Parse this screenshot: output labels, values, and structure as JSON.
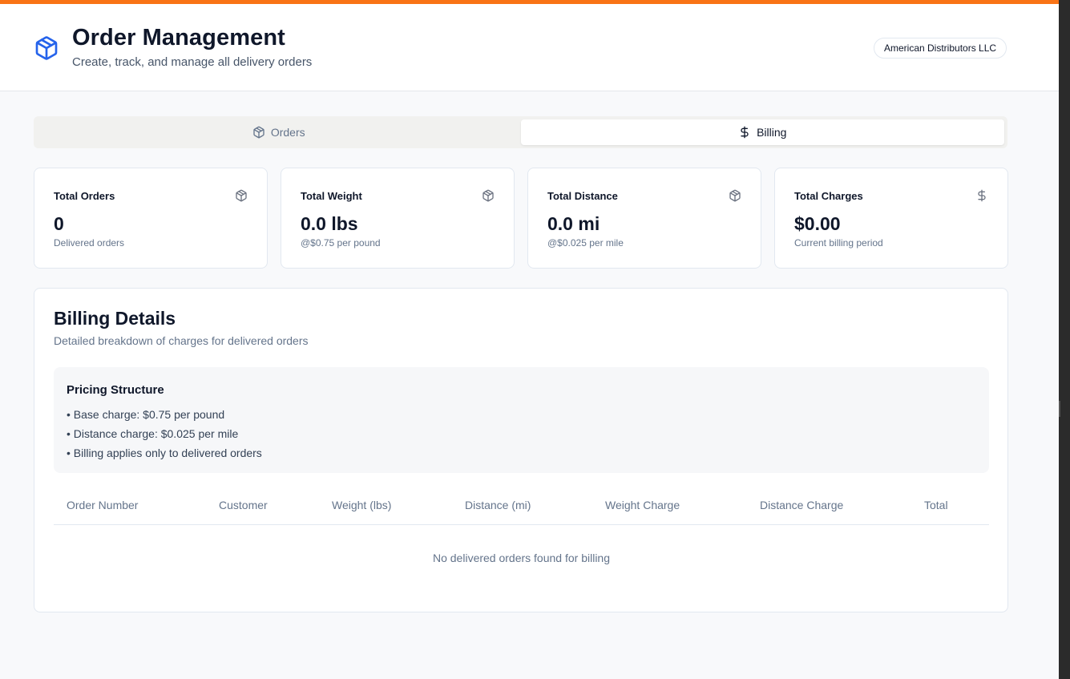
{
  "header": {
    "title": "Order Management",
    "subtitle": "Create, track, and manage all delivery orders",
    "organization": "American Distributors LLC",
    "icon": "package-icon"
  },
  "tabs": [
    {
      "label": "Orders",
      "icon": "package-icon",
      "active": false
    },
    {
      "label": "Billing",
      "icon": "dollar-icon",
      "active": true
    }
  ],
  "stats": [
    {
      "title": "Total Orders",
      "value": "0",
      "sub": "Delivered orders",
      "icon": "package-icon"
    },
    {
      "title": "Total Weight",
      "value": "0.0 lbs",
      "sub": "@$0.75 per pound",
      "icon": "package-icon"
    },
    {
      "title": "Total Distance",
      "value": "0.0 mi",
      "sub": "@$0.025 per mile",
      "icon": "package-icon"
    },
    {
      "title": "Total Charges",
      "value": "$0.00",
      "sub": "Current billing period",
      "icon": "dollar-icon"
    }
  ],
  "billing": {
    "title": "Billing Details",
    "subtitle": "Detailed breakdown of charges for delivered orders",
    "pricing": {
      "title": "Pricing Structure",
      "items": [
        "• Base charge: $0.75 per pound",
        "• Distance charge: $0.025 per mile",
        "• Billing applies only to delivered orders"
      ]
    },
    "table": {
      "columns": [
        "Order Number",
        "Customer",
        "Weight (lbs)",
        "Distance (mi)",
        "Weight Charge",
        "Distance Charge",
        "Total"
      ],
      "rows": [],
      "empty_message": "No delivered orders found for billing"
    }
  },
  "colors": {
    "accent": "#f97316",
    "brand_icon": "#2563eb",
    "text_primary": "#0f172a",
    "text_muted": "#64748b"
  }
}
